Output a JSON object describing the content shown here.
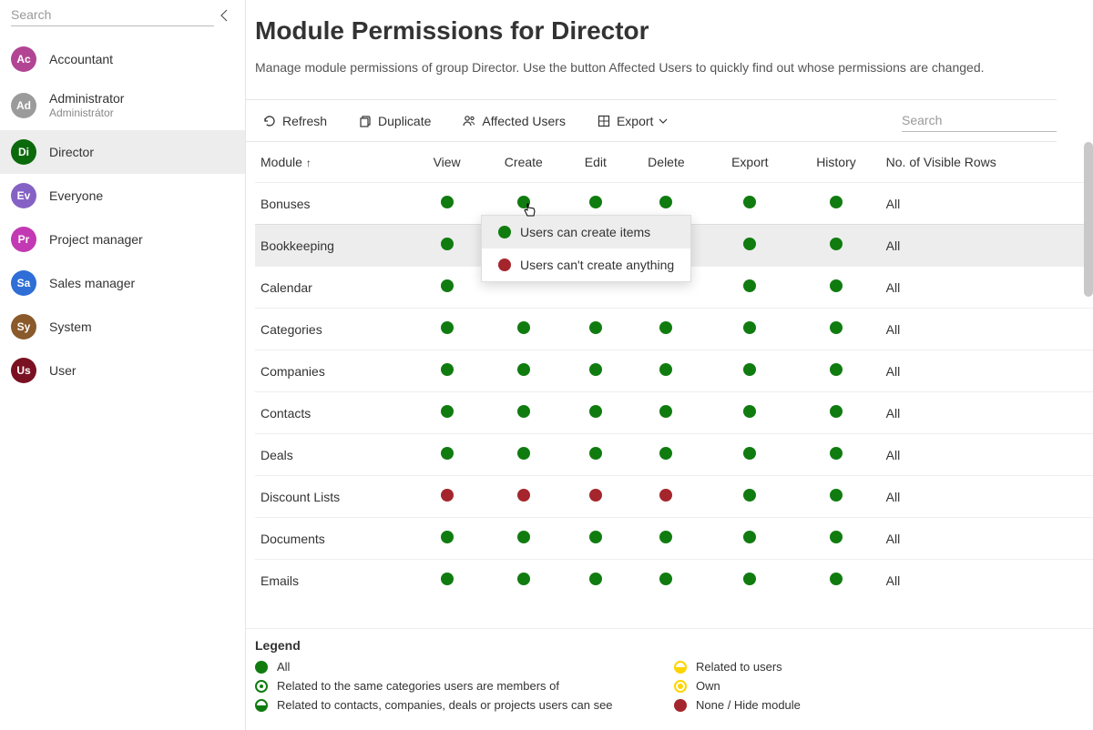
{
  "sidebar": {
    "search_placeholder": "Search",
    "groups": [
      {
        "abbr": "Ac",
        "name": "Accountant",
        "sub": "",
        "color": "#b24593",
        "selected": false
      },
      {
        "abbr": "Ad",
        "name": "Administrator",
        "sub": "Administrátor",
        "color": "#9b9b9b",
        "selected": false
      },
      {
        "abbr": "Di",
        "name": "Director",
        "sub": "",
        "color": "#0b6a0b",
        "selected": true
      },
      {
        "abbr": "Ev",
        "name": "Everyone",
        "sub": "",
        "color": "#8661c5",
        "selected": false
      },
      {
        "abbr": "Pr",
        "name": "Project manager",
        "sub": "",
        "color": "#c239b3",
        "selected": false
      },
      {
        "abbr": "Sa",
        "name": "Sales manager",
        "sub": "",
        "color": "#2e6ed6",
        "selected": false
      },
      {
        "abbr": "Sy",
        "name": "System",
        "sub": "",
        "color": "#8a5a2b",
        "selected": false
      },
      {
        "abbr": "Us",
        "name": "User",
        "sub": "",
        "color": "#7a1122",
        "selected": false
      }
    ]
  },
  "header": {
    "title": "Module Permissions for Director",
    "description": "Manage module permissions of group Director. Use the button Affected Users to quickly find out whose permissions are changed."
  },
  "toolbar": {
    "refresh": "Refresh",
    "duplicate": "Duplicate",
    "affected_users": "Affected Users",
    "export": "Export",
    "search_placeholder": "Search"
  },
  "table": {
    "columns": [
      "Module",
      "View",
      "Create",
      "Edit",
      "Delete",
      "Export",
      "History",
      "No. of Visible Rows"
    ],
    "sort_col": 0,
    "rows": [
      {
        "module": "Bonuses",
        "cells": [
          "green",
          "green",
          "green",
          "green",
          "green",
          "green"
        ],
        "visible": "All",
        "hovered": false
      },
      {
        "module": "Bookkeeping",
        "cells": [
          "green",
          "green",
          "green",
          "green",
          "green",
          "green"
        ],
        "visible": "All",
        "hovered": true
      },
      {
        "module": "Calendar",
        "cells": [
          "green",
          "",
          "",
          "",
          "green",
          "green"
        ],
        "visible": "All",
        "hovered": false
      },
      {
        "module": "Categories",
        "cells": [
          "green",
          "green",
          "green",
          "green",
          "green",
          "green"
        ],
        "visible": "All",
        "hovered": false
      },
      {
        "module": "Companies",
        "cells": [
          "green",
          "green",
          "green",
          "green",
          "green",
          "green"
        ],
        "visible": "All",
        "hovered": false
      },
      {
        "module": "Contacts",
        "cells": [
          "green",
          "green",
          "green",
          "green",
          "green",
          "green"
        ],
        "visible": "All",
        "hovered": false
      },
      {
        "module": "Deals",
        "cells": [
          "green",
          "green",
          "green",
          "green",
          "green",
          "green"
        ],
        "visible": "All",
        "hovered": false
      },
      {
        "module": "Discount Lists",
        "cells": [
          "red",
          "red",
          "red",
          "red",
          "green",
          "green"
        ],
        "visible": "All",
        "hovered": false
      },
      {
        "module": "Documents",
        "cells": [
          "green",
          "green",
          "green",
          "green",
          "green",
          "green"
        ],
        "visible": "All",
        "hovered": false
      },
      {
        "module": "Emails",
        "cells": [
          "green",
          "green",
          "green",
          "green",
          "green",
          "green"
        ],
        "visible": "All",
        "hovered": false
      }
    ]
  },
  "popup": {
    "options": [
      {
        "label": "Users can create items",
        "color": "green",
        "selected": true
      },
      {
        "label": "Users can't create anything",
        "color": "red",
        "selected": false
      }
    ]
  },
  "legend": {
    "title": "Legend",
    "left": [
      {
        "cls": "ldot-all",
        "label": "All"
      },
      {
        "cls": "ldot-cat2",
        "label": "Related to the same categories users are members of"
      },
      {
        "cls": "ldot-contacts",
        "label": "Related to contacts, companies, deals or projects users can see"
      }
    ],
    "right": [
      {
        "cls": "ldot-users-in",
        "label": "Related to users"
      },
      {
        "cls": "ldot-own",
        "label": "Own"
      },
      {
        "cls": "ldot-none",
        "label": "None / Hide module"
      }
    ]
  }
}
